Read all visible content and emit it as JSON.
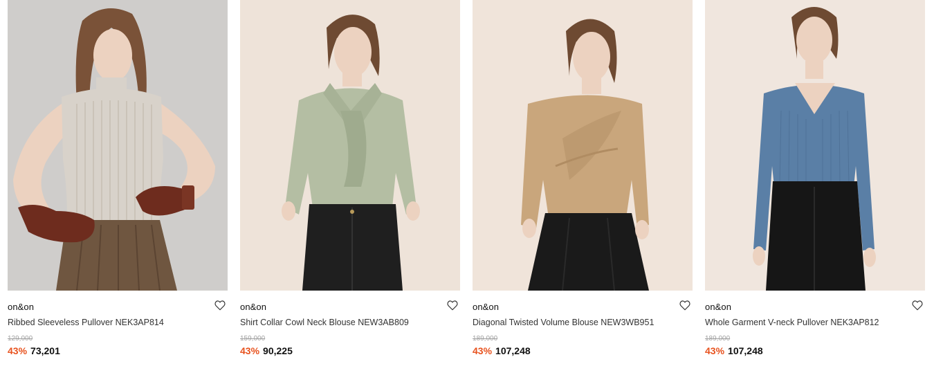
{
  "products": [
    {
      "brand": "on&on",
      "name": "Ribbed Sleeveless Pullover NEK3AP814",
      "original_price": "129,000",
      "discount": "43%",
      "price": "73,201",
      "photo": {
        "bg": "#cfcdcb",
        "top": "#d8d2ca",
        "bottom": "#6f5640",
        "gloves": "#6e2c1e",
        "hair": "#7a5238"
      }
    },
    {
      "brand": "on&on",
      "name": "Shirt Collar Cowl Neck Blouse NEW3AB809",
      "original_price": "159,000",
      "discount": "43%",
      "price": "90,225",
      "photo": {
        "bg": "#eee3d9",
        "top": "#b4bea3",
        "bottom": "#1f1f1f",
        "hair": "#6e4a32"
      }
    },
    {
      "brand": "on&on",
      "name": "Diagonal Twisted Volume Blouse NEW3WB951",
      "original_price": "189,000",
      "discount": "43%",
      "price": "107,248",
      "photo": {
        "bg": "#f0e4da",
        "top": "#c9a67c",
        "bottom": "#1a1a1a",
        "hair": "#6e4a32"
      }
    },
    {
      "brand": "on&on",
      "name": "Whole Garment V-neck Pullover NEK3AP812",
      "original_price": "189,000",
      "discount": "43%",
      "price": "107,248",
      "photo": {
        "bg": "#f0e6de",
        "top": "#5a7fa6",
        "bottom": "#161616",
        "hair": "#6e4a32"
      }
    }
  ],
  "icons": {
    "wishlist": "heart-outline-icon"
  },
  "colors": {
    "discount": "#e8531f",
    "original_price": "#a3a3a3"
  }
}
